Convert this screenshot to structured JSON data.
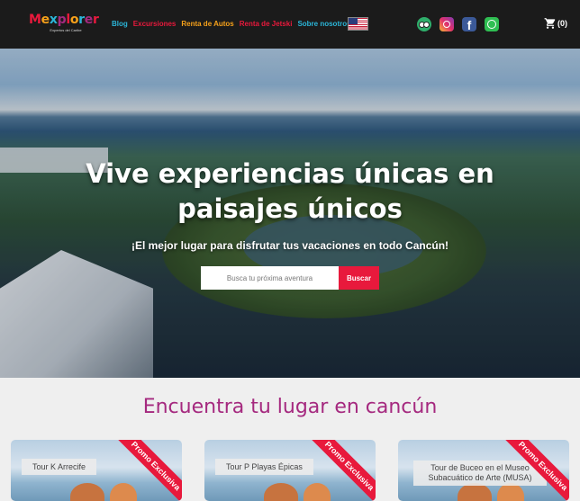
{
  "brand": {
    "name_parts": [
      {
        "text": "M",
        "color": "#e8193c"
      },
      {
        "text": "e",
        "color": "#f7a11a"
      },
      {
        "text": "x",
        "color": "#2bb5d8"
      },
      {
        "text": "p",
        "color": "#a5297f"
      },
      {
        "text": "l",
        "color": "#e8193c"
      },
      {
        "text": "o",
        "color": "#f7a11a"
      },
      {
        "text": "r",
        "color": "#2bb5d8"
      },
      {
        "text": "e",
        "color": "#a5297f"
      },
      {
        "text": "r",
        "color": "#e8193c"
      }
    ],
    "tagline": "Expertos del Caribe"
  },
  "nav": {
    "links": [
      {
        "label": "Blog",
        "color": "#2bb5d8"
      },
      {
        "label": "Excursiones",
        "color": "#e8193c"
      },
      {
        "label": "Renta de Autos",
        "color": "#f7a11a"
      },
      {
        "label": "Renta de Jetski",
        "color": "#e8193c"
      },
      {
        "label": "Sobre nosotros",
        "color": "#2bb5d8"
      }
    ],
    "language_flag": "us-flag-icon",
    "social": [
      "tripadvisor-icon",
      "instagram-icon",
      "facebook-icon",
      "whatsapp-icon"
    ],
    "cart_count": "(0)"
  },
  "hero": {
    "title": "Vive experiencias únicas en paisajes únicos",
    "subtitle": "¡El mejor lugar para disfrutar tus vacaciones en todo Cancún!",
    "search_placeholder": "Busca tu próxima aventura",
    "search_button": "Buscar"
  },
  "section": {
    "title": "Encuentra tu lugar en cancún",
    "cards": [
      {
        "label": "Tour K Arrecife",
        "badge": "Promo Exclusiva"
      },
      {
        "label": "Tour P Playas Épicas",
        "badge": "Promo Exclusiva"
      },
      {
        "label": "Tour de Buceo en el Museo Subacuático de Arte (MUSA)",
        "badge": "Promo Exclusiva"
      }
    ]
  },
  "colors": {
    "accent_red": "#e8193c",
    "accent_purple": "#a5297f",
    "navbar_bg": "#1b1b1b"
  }
}
